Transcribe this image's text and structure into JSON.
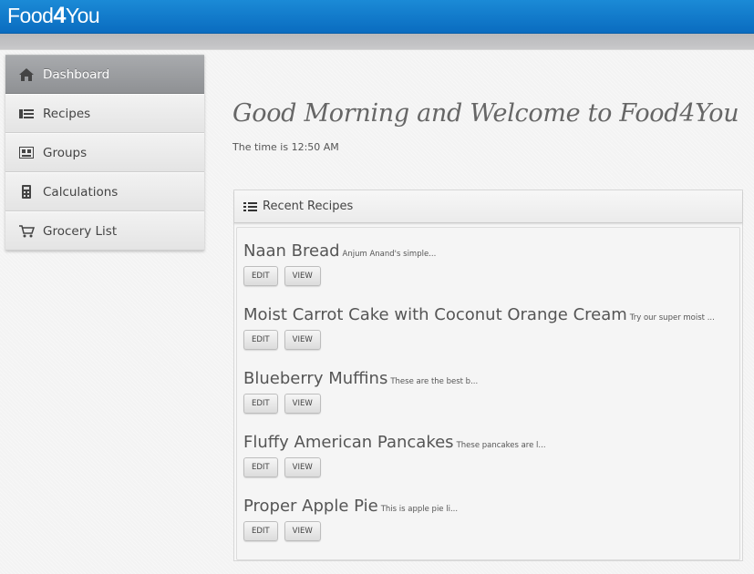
{
  "header": {
    "logo_prefix": "Food",
    "logo_number": "4",
    "logo_suffix": "You"
  },
  "sidebar": {
    "items": [
      {
        "label": "Dashboard",
        "icon": "home-icon",
        "active": true
      },
      {
        "label": "Recipes",
        "icon": "list-icon"
      },
      {
        "label": "Groups",
        "icon": "groups-icon"
      },
      {
        "label": "Calculations",
        "icon": "calculator-icon"
      },
      {
        "label": "Grocery List",
        "icon": "cart-icon"
      }
    ]
  },
  "main": {
    "greeting": "Good Morning and Welcome to Food4You",
    "time_text": "The time is 12:50 AM"
  },
  "recent": {
    "title": "Recent Recipes",
    "edit_label": "EDIT",
    "view_label": "VIEW",
    "items": [
      {
        "title": "Naan Bread",
        "desc": "Anjum Anand's simple..."
      },
      {
        "title": "Moist Carrot Cake with Coconut Orange Cream",
        "desc": "Try our super moist ..."
      },
      {
        "title": "Blueberry Muffins",
        "desc": "These are the best b..."
      },
      {
        "title": "Fluffy American Pancakes",
        "desc": "These pancakes are l..."
      },
      {
        "title": "Proper Apple Pie",
        "desc": "This is apple pie li..."
      }
    ]
  },
  "colors": {
    "header_blue": "#0a6cc0",
    "active_nav": "#8f9194"
  }
}
